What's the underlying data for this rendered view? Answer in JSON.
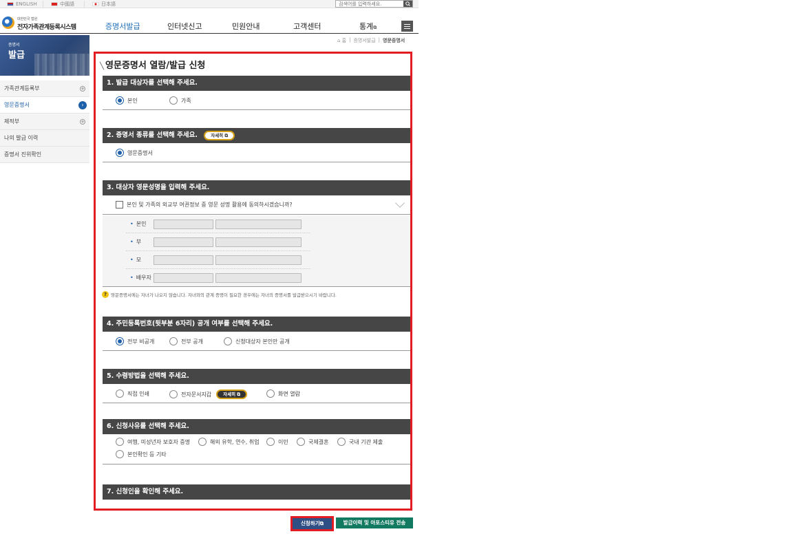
{
  "topbar": {
    "languages": [
      "ENGLISH",
      "中國語",
      "日本語"
    ],
    "search_placeholder": "검색어를 입력하세요."
  },
  "header": {
    "logo_small": "대한민국 법원",
    "logo_title": "전자가족관계등록시스템",
    "nav": [
      "증명서발급",
      "인터넷신고",
      "민원안내",
      "고객센터",
      "통계"
    ],
    "active_nav": "증명서발급"
  },
  "breadcrumb": [
    "증명서발급",
    "영문증명서"
  ],
  "sidebar": {
    "banner_small": "증명서",
    "banner_large": "발급",
    "items": [
      {
        "label": "가족관계등록부",
        "icon": "plus-icon"
      },
      {
        "label": "영문증명서",
        "icon": "arrow-icon",
        "active": true
      },
      {
        "label": "제적부",
        "icon": "plus-icon"
      },
      {
        "label": "나의 발급 이력",
        "icon": ""
      },
      {
        "label": "증명서 진위확인",
        "icon": ""
      }
    ]
  },
  "form": {
    "title": "영문증명서 열람/발급 신청",
    "sections": {
      "s1": {
        "title": "1. 발급 대상자를 선택해 주세요.",
        "options": [
          "본인",
          "가족"
        ],
        "selected": "본인"
      },
      "s2": {
        "title": "2. 증명서 종류를 선택해 주세요.",
        "detail_label": "자세히",
        "options": [
          "영문증명서"
        ],
        "selected": "영문증명서"
      },
      "s3": {
        "title": "3. 대상자 영문성명을 입력해 주세요.",
        "consent_text": "본인 및 가족의 외교부 여권정보 중 영문 성명 활용에 동의하시겠습니까?",
        "rows": [
          "본인",
          "부",
          "모",
          "배우자"
        ],
        "notice": "영문증명서에는 자녀가 나오지 않습니다. 자녀와의 관계 증명이 필요한 경우에는 자녀의 증명서를 발급받으시기 바랍니다."
      },
      "s4": {
        "title": "4. 주민등록번호(뒷부분 6자리) 공개 여부를 선택해 주세요.",
        "options": [
          "전부 비공개",
          "전부 공개",
          "신청대상자 본인만 공개"
        ],
        "selected": "전부 비공개"
      },
      "s5": {
        "title": "5. 수령방법을 선택해 주세요.",
        "options": [
          "직접 인쇄",
          "전자문서지갑",
          "화면 열람"
        ],
        "detail_label": "자세히"
      },
      "s6": {
        "title": "6. 신청사유를 선택해 주세요.",
        "options": [
          "여행, 미성년자 보호자 증명",
          "해외 유학, 연수, 취업",
          "이민",
          "국제결혼",
          "국내 기관 제출",
          "본인확인 등 기타"
        ]
      },
      "s7": {
        "title": "7. 신청인을 확인해 주세요."
      }
    }
  },
  "buttons": {
    "apply": "신청하기",
    "history": "발급이력 및 아포스티유 전송"
  },
  "colors": {
    "accent": "#1d5fa8",
    "highlight": "#e31b23",
    "section_header": "#464646",
    "history_button": "#137a62"
  }
}
